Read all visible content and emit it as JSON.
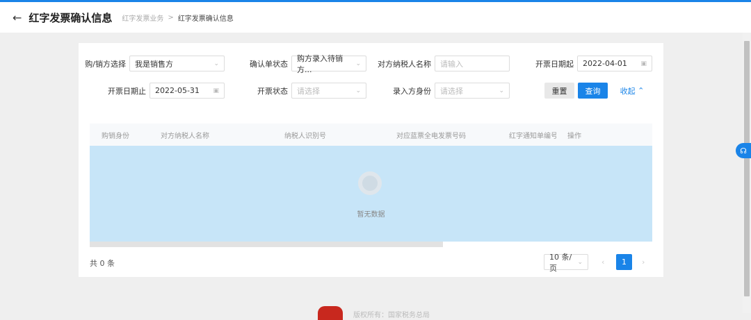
{
  "header": {
    "back_icon": "arrow-left-icon",
    "title": "红字发票确认信息",
    "breadcrumb": [
      "红字发票业务",
      "红字发票确认信息"
    ],
    "separator": ">"
  },
  "filters": {
    "buyer_seller": {
      "label": "购/销方选择",
      "value": "我是销售方"
    },
    "confirm_status": {
      "label": "确认单状态",
      "value": "购方录入待销方..."
    },
    "counterparty_name": {
      "label": "对方纳税人名称",
      "placeholder": "请输入"
    },
    "date_start": {
      "label": "开票日期起",
      "value": "2022-04-01"
    },
    "date_end": {
      "label": "开票日期止",
      "value": "2022-05-31"
    },
    "invoice_status": {
      "label": "开票状态",
      "placeholder": "请选择"
    },
    "entry_identity": {
      "label": "录入方身份",
      "placeholder": "请选择"
    },
    "reset": "重置",
    "query": "查询",
    "collapse": "收起"
  },
  "table": {
    "columns": [
      "购销身份",
      "对方纳税人名称",
      "纳税人识别号",
      "对应蓝票全电发票号码",
      "红字通知单编号",
      "操作"
    ],
    "rows": [],
    "empty_text": "暂无数据"
  },
  "pagination": {
    "total": "共 0 条",
    "page_size": "10 条/页",
    "current_page": "1"
  },
  "footer": {
    "text": "版权所有：国家税务总局"
  },
  "colors": {
    "accent": "#1a84e8",
    "table_body": "#c7e5f8"
  }
}
